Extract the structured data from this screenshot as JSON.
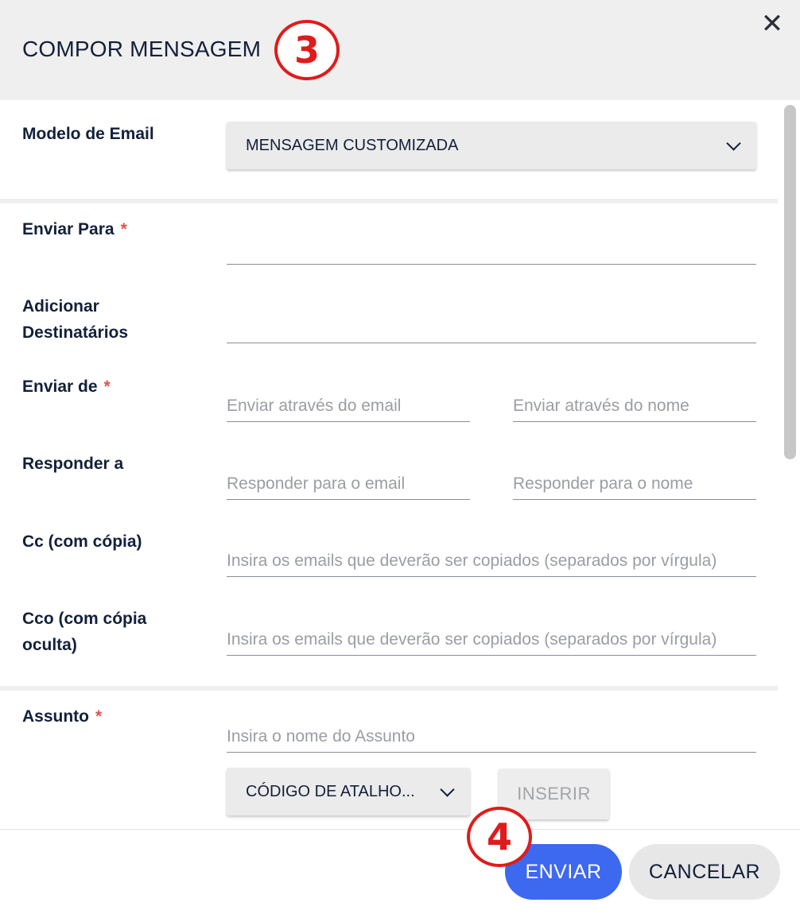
{
  "header": {
    "title": "COMPOR MENSAGEM",
    "step_badge": "3",
    "close_icon": "close-icon"
  },
  "colors": {
    "accent_blue": "#3d68f0",
    "required_asterisk": "#e0544f",
    "annotation_red": "#e01b1b",
    "header_bg": "#efefef"
  },
  "form": {
    "template": {
      "label": "Modelo de Email",
      "value": "MENSAGEM CUSTOMIZADA"
    },
    "send_to": {
      "label": "Enviar Para",
      "required": "*",
      "value": ""
    },
    "add_recipients": {
      "label_line1": "Adicionar",
      "label_line2": "Destinatários",
      "value": ""
    },
    "send_from": {
      "label": "Enviar de",
      "required": "*",
      "email_placeholder": "Enviar através do email",
      "name_placeholder": "Enviar através do nome"
    },
    "reply_to": {
      "label": "Responder a",
      "email_placeholder": "Responder para o email",
      "name_placeholder": "Responder para o nome"
    },
    "cc": {
      "label": "Cc (com cópia)",
      "placeholder": "Insira os emails que deverão ser copiados (separados por vírgula)"
    },
    "bcc": {
      "label_line1": "Cco (com cópia",
      "label_line2": "oculta)",
      "placeholder": "Insira os emails que deverão ser copiados (separados por vírgula)"
    },
    "subject": {
      "label": "Assunto",
      "required": "*",
      "placeholder": "Insira o nome do Assunto"
    },
    "shortcut": {
      "value": "CÓDIGO DE ATALHO...",
      "insert_label": "INSERIR"
    }
  },
  "footer": {
    "step_badge": "4",
    "send_label": "ENVIAR",
    "cancel_label": "CANCELAR"
  }
}
